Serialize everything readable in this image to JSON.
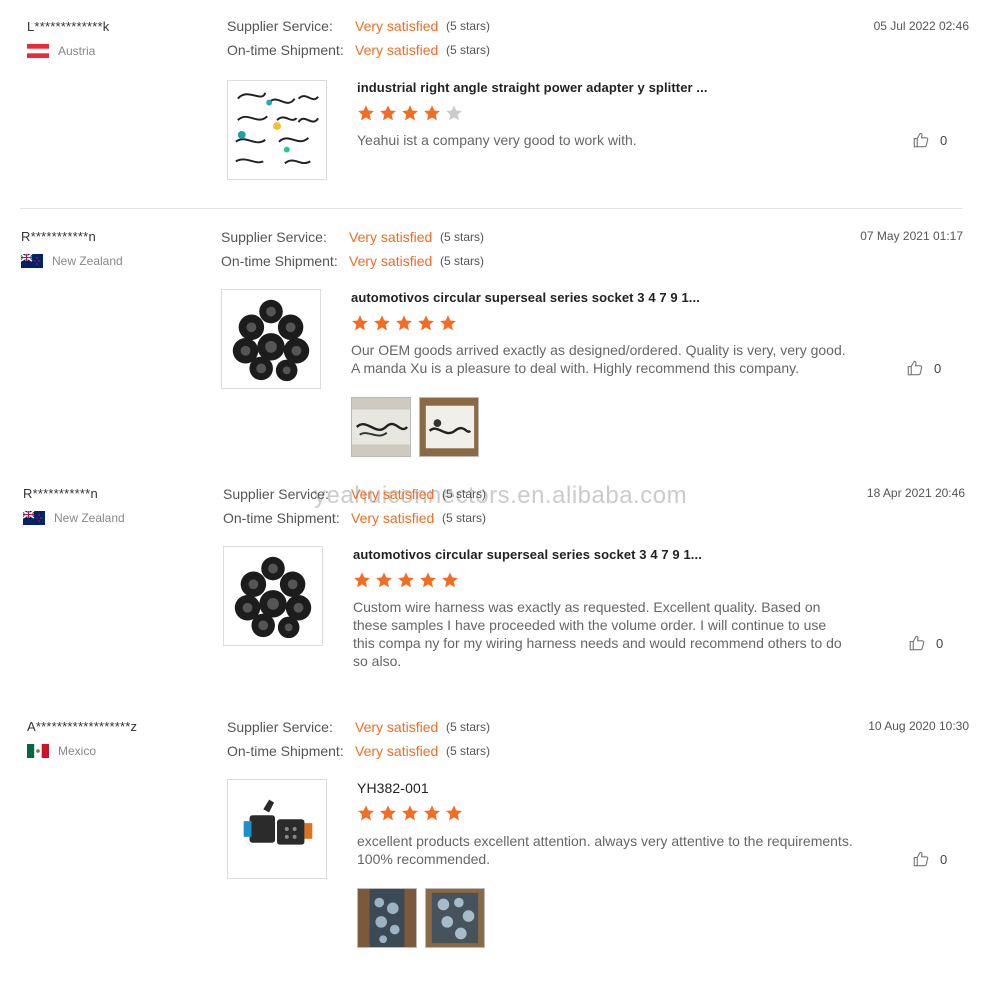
{
  "watermark": "yeahuiconnectors.en.alibaba.com",
  "labels": {
    "supplier_service": "Supplier Service:",
    "ontime_shipment": "On-time Shipment:"
  },
  "colors": {
    "accent": "#f36c21",
    "star_empty": "#cccccc"
  },
  "reviews": [
    {
      "name": "L*************k",
      "country": "Austria",
      "flag": "austria-flag",
      "supplier_service": "Very satisfied",
      "supplier_service_stars": "(5 stars)",
      "ontime_shipment": "Very satisfied",
      "ontime_shipment_stars": "(5 stars)",
      "date": "05 Jul 2022 02:46",
      "product_title": "industrial right angle straight power adapter y splitter ...",
      "rating": 4,
      "comment": "Yeahui ist a company very good to work with.",
      "likes": "0",
      "product_image": "cable-assortment-image",
      "extra_images": []
    },
    {
      "name": "R***********n",
      "country": "New Zealand",
      "flag": "new-zealand-flag",
      "supplier_service": "Very satisfied",
      "supplier_service_stars": "(5 stars)",
      "ontime_shipment": "Very satisfied",
      "ontime_shipment_stars": "(5 stars)",
      "date": "07 May 2021 01:17",
      "product_title": "automotivos circular superseal series socket 3 4 7 9 1...",
      "rating": 5,
      "comment": "Our OEM goods arrived exactly as designed/ordered. Quality is very, very good. A manda Xu is a pleasure to deal with. Highly recommend this company.",
      "likes": "0",
      "product_image": "circular-connectors-image",
      "extra_images": [
        "buyer-photo-cables-1",
        "buyer-photo-cables-2"
      ]
    },
    {
      "name": "R***********n",
      "country": "New Zealand",
      "flag": "new-zealand-flag",
      "supplier_service": "Very satisfied",
      "supplier_service_stars": "(5 stars)",
      "ontime_shipment": "Very satisfied",
      "ontime_shipment_stars": "(5 stars)",
      "date": "18 Apr 2021 20:46",
      "product_title": "automotivos circular superseal series socket 3 4 7 9 1...",
      "rating": 5,
      "comment": "Custom wire harness was exactly as requested. Excellent quality. Based on these samples I have proceeded with the volume order. I will continue to use this compa ny for my wiring harness needs and would recommend others to do so also.",
      "likes": "0",
      "product_image": "circular-connectors-image",
      "extra_images": []
    },
    {
      "name": "A******************z",
      "country": "Mexico",
      "flag": "mexico-flag",
      "supplier_service": "Very satisfied",
      "supplier_service_stars": "(5 stars)",
      "ontime_shipment": "Very satisfied",
      "ontime_shipment_stars": "(5 stars)",
      "date": "10 Aug 2020 10:30",
      "product_title": "YH382-001",
      "rating": 5,
      "comment": "excellent products excellent attention. always very attentive to the requirements. 100% recommended.",
      "likes": "0",
      "product_image": "dt-connector-image",
      "extra_images": [
        "buyer-photo-packages-1",
        "buyer-photo-packages-2"
      ]
    }
  ]
}
